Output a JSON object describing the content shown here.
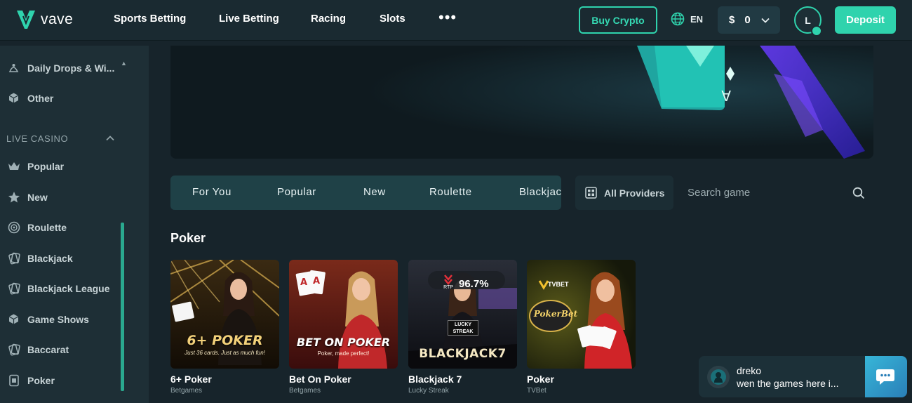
{
  "brand": {
    "name": "vave",
    "accent": "#2fd3ad"
  },
  "nav": {
    "items": [
      "Sports Betting",
      "Live Betting",
      "Racing",
      "Slots"
    ],
    "more_icon": "ellipsis-icon"
  },
  "header": {
    "buy_crypto": "Buy Crypto",
    "language": "EN",
    "balance_currency": "$",
    "balance_value": "0",
    "avatar_initial": "L",
    "deposit": "Deposit"
  },
  "sidebar": {
    "items_top": [
      {
        "label": "Daily Drops & Wi...",
        "icon": "drops-icon"
      },
      {
        "label": "Other",
        "icon": "cube-icon"
      }
    ],
    "section_label": "LIVE CASINO",
    "items_live": [
      {
        "label": "Popular",
        "icon": "crown-icon"
      },
      {
        "label": "New",
        "icon": "star-icon"
      },
      {
        "label": "Roulette",
        "icon": "roulette-icon"
      },
      {
        "label": "Blackjack",
        "icon": "cards-icon"
      },
      {
        "label": "Blackjack League",
        "icon": "cards-icon"
      },
      {
        "label": "Game Shows",
        "icon": "cube-icon"
      },
      {
        "label": "Baccarat",
        "icon": "cards-icon"
      },
      {
        "label": "Poker",
        "icon": "card-icon"
      }
    ]
  },
  "tabs": [
    "For You",
    "Popular",
    "New",
    "Roulette",
    "Blackjack"
  ],
  "filters": {
    "providers_label": "All Providers",
    "search_placeholder": "Search game"
  },
  "section": {
    "title": "Poker",
    "games": [
      {
        "name": "6+ Poker",
        "provider": "Betgames",
        "art_title": "6+ POKER",
        "art_sub": "Just 36 cards. Just as much fun!"
      },
      {
        "name": "Bet On Poker",
        "provider": "Betgames",
        "art_title": "BET ON POKER",
        "art_sub": "Poker, made perfect!"
      },
      {
        "name": "Blackjack 7",
        "provider": "Lucky Streak",
        "art_title": "BLACKJACK7",
        "rtp_label": "RTP",
        "rtp_value": "96.7%",
        "art_badge": "LUCKY STREAK"
      },
      {
        "name": "Poker",
        "provider": "TVBet",
        "art_title": "PokerBet",
        "art_brand": "TVBET"
      }
    ]
  },
  "chat": {
    "user": "dreko",
    "message": "wen the games here i..."
  }
}
